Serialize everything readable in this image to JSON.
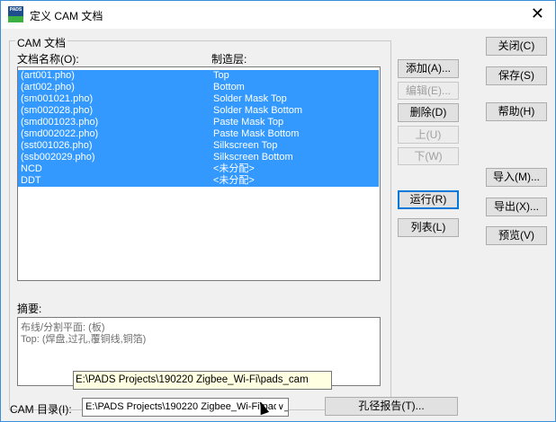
{
  "window": {
    "title": "定义 CAM 文档",
    "app_icon_text": "PADS"
  },
  "group": {
    "legend": "CAM 文档"
  },
  "list": {
    "headers": {
      "name": "文档名称(O):",
      "layer": "制造层:"
    },
    "rows": [
      {
        "name": "(art001.pho)",
        "layer": "Top"
      },
      {
        "name": "(art002.pho)",
        "layer": "Bottom"
      },
      {
        "name": "(sm001021.pho)",
        "layer": "Solder Mask Top"
      },
      {
        "name": "(sm002028.pho)",
        "layer": "Solder Mask Bottom"
      },
      {
        "name": "(smd001023.pho)",
        "layer": "Paste Mask Top"
      },
      {
        "name": "(smd002022.pho)",
        "layer": "Paste Mask Bottom"
      },
      {
        "name": "(sst001026.pho)",
        "layer": "Silkscreen Top"
      },
      {
        "name": "(ssb002029.pho)",
        "layer": "Silkscreen Bottom"
      },
      {
        "name": "NCD",
        "layer": "<未分配>"
      },
      {
        "name": "DDT",
        "layer": "<未分配>"
      }
    ]
  },
  "summary": {
    "label": "摘要:",
    "lines": [
      "布线/分割平面: (板)",
      "Top: (焊盘,过孔,覆铜线,铜箔)"
    ]
  },
  "tooltip": "E:\\PADS Projects\\190220 Zigbee_Wi-Fi\\pads_cam",
  "buttons": {
    "add": "添加(A)...",
    "edit": "编辑(E)...",
    "delete": "删除(D)",
    "up": "上(U)",
    "down": "下(W)",
    "run": "运行(R)",
    "list": "列表(L)",
    "close": "关闭(C)",
    "save": "保存(S)",
    "help": "帮助(H)",
    "import": "导入(M)...",
    "export": "导出(X)...",
    "preview": "预览(V)",
    "drill_report": "孔径报告(T)..."
  },
  "cam_dir": {
    "label": "CAM 目录(I):",
    "value": "E:\\PADS Projects\\190220 Zigbee_Wi-Fi\\pads_cam"
  }
}
